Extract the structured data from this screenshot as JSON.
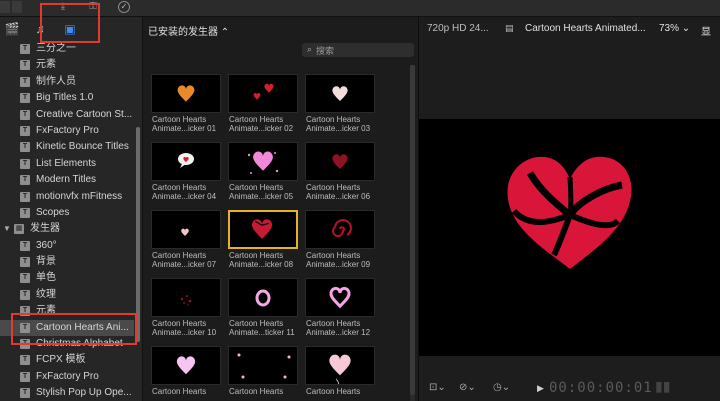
{
  "sidebar": {
    "items": [
      {
        "label": "三分之一",
        "type": "item",
        "indent": 36
      },
      {
        "label": "元素",
        "type": "item",
        "indent": 36
      },
      {
        "label": "制作人员",
        "type": "item",
        "indent": 36
      },
      {
        "label": "Big Titles 1.0",
        "type": "item",
        "indent": 36
      },
      {
        "label": "Creative Cartoon St...",
        "type": "item",
        "indent": 36
      },
      {
        "label": "FxFactory Pro",
        "type": "item",
        "indent": 36
      },
      {
        "label": "Kinetic Bounce Titles",
        "type": "item",
        "indent": 36
      },
      {
        "label": "List Elements",
        "type": "item",
        "indent": 36
      },
      {
        "label": "Modern Titles",
        "type": "item",
        "indent": 36
      },
      {
        "label": "motionvfx mFitness",
        "type": "item",
        "indent": 36
      },
      {
        "label": "Scopes",
        "type": "item",
        "indent": 36
      },
      {
        "label": "发生器",
        "type": "group",
        "indent": 30
      },
      {
        "label": "360°",
        "type": "item",
        "indent": 36
      },
      {
        "label": "背景",
        "type": "item",
        "indent": 36
      },
      {
        "label": "单色",
        "type": "item",
        "indent": 36
      },
      {
        "label": "纹理",
        "type": "item",
        "indent": 36
      },
      {
        "label": "元素",
        "type": "item",
        "indent": 36
      },
      {
        "label": "Cartoon Hearts Ani...",
        "type": "item",
        "indent": 36,
        "selected": true
      },
      {
        "label": "Christmas Alphabet",
        "type": "item",
        "indent": 36
      },
      {
        "label": "FCPX 模板",
        "type": "item",
        "indent": 36
      },
      {
        "label": "FxFactory Pro",
        "type": "item",
        "indent": 36
      },
      {
        "label": "Stylish Pop Up Ope...",
        "type": "item",
        "indent": 36
      }
    ]
  },
  "browser": {
    "title": "已安装的发生器 ⌃",
    "search_placeholder": "搜索",
    "tiles": [
      {
        "line1": "Cartoon Hearts",
        "line2": "Animate...icker 01",
        "art": "heart-orange"
      },
      {
        "line1": "Cartoon Hearts",
        "line2": "Animate...icker 02",
        "art": "hearts-small-red"
      },
      {
        "line1": "Cartoon Hearts",
        "line2": "Animate...icker 03",
        "art": "heart-white"
      },
      {
        "line1": "Cartoon Hearts",
        "line2": "Animate...icker 04",
        "art": "speech-heart"
      },
      {
        "line1": "Cartoon Hearts",
        "line2": "Animate...icker 05",
        "art": "heart-pink-sparkle"
      },
      {
        "line1": "Cartoon Hearts",
        "line2": "Animate...icker 06",
        "art": "heart-darkred"
      },
      {
        "line1": "Cartoon Hearts",
        "line2": "Animate...icker 07",
        "art": "heart-tiny-pink"
      },
      {
        "line1": "Cartoon Hearts",
        "line2": "Animate...icker 08",
        "art": "heart-swirl",
        "selected": true
      },
      {
        "line1": "Cartoon Hearts",
        "line2": "Animate...icker 09",
        "art": "spiral-red"
      },
      {
        "line1": "Cartoon Hearts",
        "line2": "Animate...icker 10",
        "art": "dots-red"
      },
      {
        "line1": "Cartoon Hearts",
        "line2": "Animate...ticker 11",
        "art": "ring-pink"
      },
      {
        "line1": "Cartoon Hearts",
        "line2": "Animate...icker 12",
        "art": "heart-outline-pink"
      },
      {
        "line1": "Cartoon Hearts",
        "line2": "",
        "art": "heart-light-pink"
      },
      {
        "line1": "Cartoon Hearts",
        "line2": "",
        "art": "confetti-pink"
      },
      {
        "line1": "Cartoon Hearts",
        "line2": "",
        "art": "heart-balloon"
      }
    ]
  },
  "viewer": {
    "format": "720p HD 24...",
    "title": "Cartoon Hearts Animated...",
    "zoom": "73% ⌄",
    "display": "显",
    "timecode": "00:00:00:01"
  },
  "colors": {
    "accent_blue": "#3f8cf3",
    "heart_red": "#d9163a",
    "selection_yellow": "#e5b32a",
    "annotation_red": "#e23a2e"
  }
}
